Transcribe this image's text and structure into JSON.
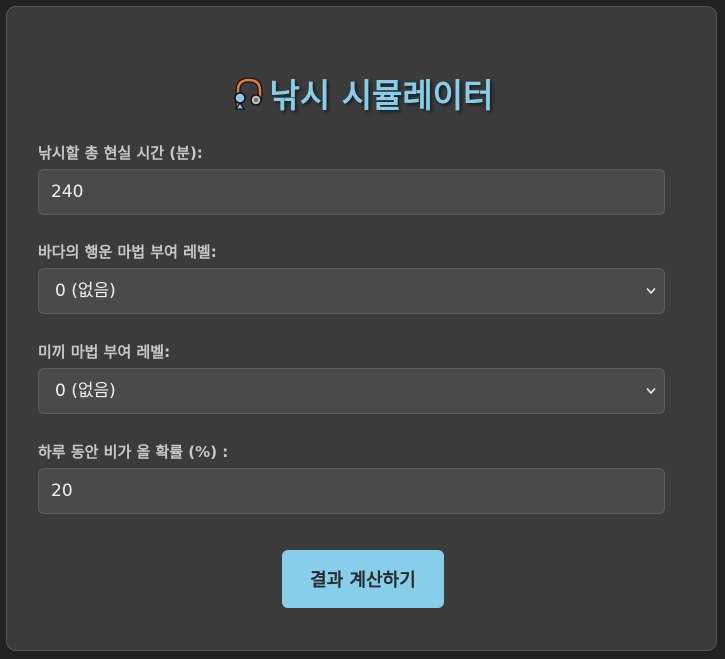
{
  "title": "낚시 시뮬레이터",
  "title_icon": "fishing-pole-icon",
  "fields": [
    {
      "label": "낚시할 총 현실 시간 (분):",
      "value": "240",
      "type": "input"
    },
    {
      "label": "바다의 행운 마법 부여 레벨:",
      "value": "0 (없음)",
      "type": "select"
    },
    {
      "label": "미끼 마법 부여 레벨:",
      "value": "0 (없음)",
      "type": "select"
    },
    {
      "label": "하루 동안 비가 올 확률 (%) :",
      "value": "20",
      "type": "input"
    }
  ],
  "button": {
    "label": "결과 계산하기"
  },
  "colors": {
    "accent": "#87ceeb",
    "panel": "#3b3b3b",
    "field": "#4a4a4a",
    "background": "#222222"
  }
}
